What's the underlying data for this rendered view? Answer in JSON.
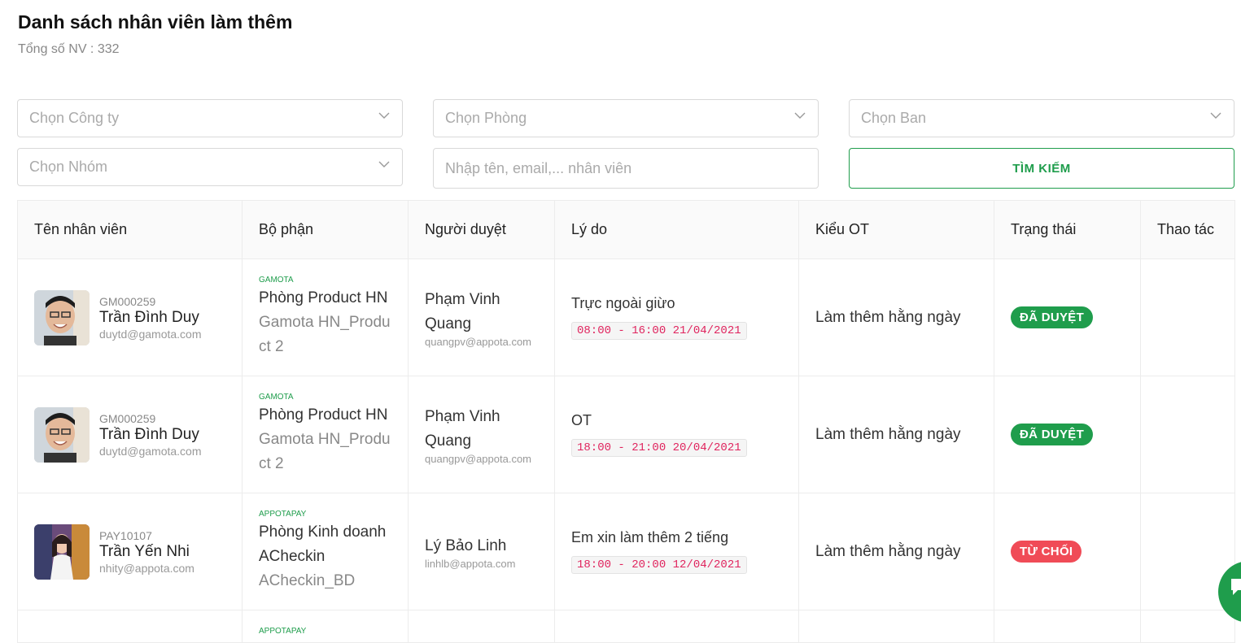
{
  "page": {
    "title": "Danh sách nhân viên làm thêm",
    "total_label": "Tổng số NV : 332"
  },
  "filters": {
    "company_placeholder": "Chọn Công ty",
    "room_placeholder": "Chọn Phòng",
    "board_placeholder": "Chọn Ban",
    "group_placeholder": "Chọn Nhóm",
    "search_placeholder": "Nhập tên, email,... nhân viên",
    "search_button": "TÌM KIẾM"
  },
  "table": {
    "columns": [
      "Tên nhân viên",
      "Bộ phận",
      "Người duyệt",
      "Lý do",
      "Kiểu OT",
      "Trạng thái",
      "Thao tác"
    ],
    "rows": [
      {
        "emp_code": "GM000259",
        "emp_name": "Trần Đình Duy",
        "emp_email": "duytd@gamota.com",
        "company": "GAMOTA",
        "department": "Phòng Product HN",
        "team": "Gamota HN_Product 2",
        "approver_name": "Phạm Vinh Quang",
        "approver_email": "quangpv@appota.com",
        "reason": "Trực ngoài giừo",
        "time_range": "08:00 - 16:00 21/04/2021",
        "ot_type": "Làm thêm hằng ngày",
        "status": "ĐÃ DUYỆT",
        "status_color": "#1f9d4c"
      },
      {
        "emp_code": "GM000259",
        "emp_name": "Trần Đình Duy",
        "emp_email": "duytd@gamota.com",
        "company": "GAMOTA",
        "department": "Phòng Product HN",
        "team": "Gamota HN_Product 2",
        "approver_name": "Phạm Vinh Quang",
        "approver_email": "quangpv@appota.com",
        "reason": "OT",
        "time_range": "18:00 - 21:00 20/04/2021",
        "ot_type": "Làm thêm hằng ngày",
        "status": "ĐÃ DUYỆT",
        "status_color": "#1f9d4c"
      },
      {
        "emp_code": "PAY10107",
        "emp_name": "Trần Yến Nhi",
        "emp_email": "nhity@appota.com",
        "company": "APPOTAPAY",
        "department": "Phòng Kinh doanh ACheckin",
        "team": "ACheckin_BD",
        "approver_name": "Lý Bảo Linh",
        "approver_email": "linhlb@appota.com",
        "reason": "Em xin làm thêm 2 tiếng",
        "time_range": "18:00 - 20:00 12/04/2021",
        "ot_type": "Làm thêm hằng ngày",
        "status": "TỪ CHỐI",
        "status_color": "#f04b57"
      }
    ],
    "partial_row": {
      "company": "APPOTAPAY"
    }
  }
}
